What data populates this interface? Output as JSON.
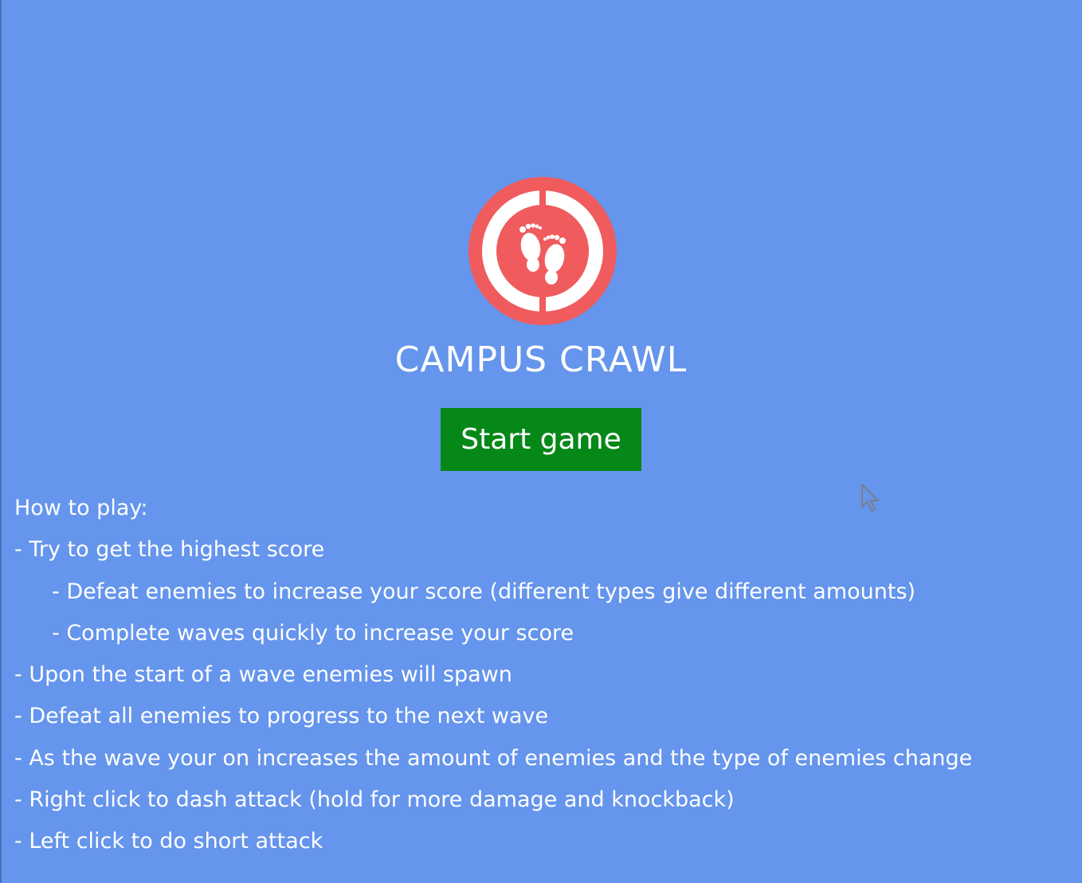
{
  "game": {
    "title": "CAMPUS CRAWL",
    "start_button_label": "Start game",
    "logo_icon": "footprints-icon",
    "colors": {
      "background": "#6595ec",
      "logo_ring": "#f05b5e",
      "button": "#068819",
      "text": "#ffffff"
    }
  },
  "how_to_play": {
    "heading": "How to play:",
    "lines": [
      "- Try to get the highest score",
      "- Defeat enemies to increase your score (different types give different amounts)",
      "- Complete waves quickly to increase your score",
      "- Upon the start of a wave enemies will spawn",
      "- Defeat all enemies to progress to the next wave",
      "- As the wave your on increases the amount of enemies and the type of enemies change",
      "- Right click to dash attack (hold for more damage and knockback)",
      "- Left click to do short attack"
    ]
  }
}
